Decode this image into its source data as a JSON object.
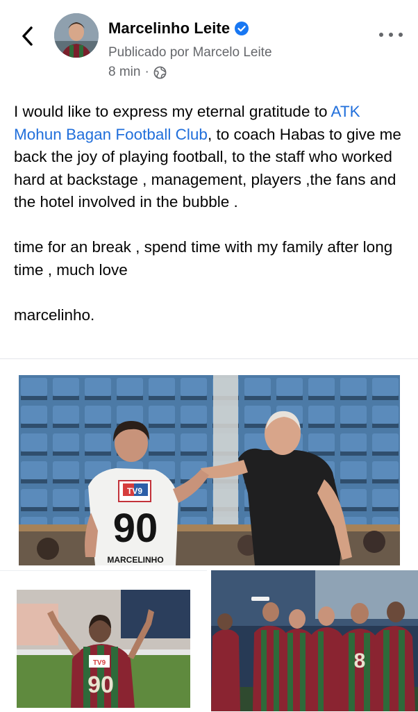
{
  "header": {
    "author_name": "Marcelinho Leite",
    "published_by": "Publicado por Marcelo Leite",
    "time": "8 min",
    "separator": "·"
  },
  "icons": {
    "back": "chevron-left-icon",
    "verified": "verified-badge-icon",
    "audience": "globe-icon",
    "more": "more-horizontal-icon"
  },
  "post": {
    "p1_before": "I would like to express my eternal gratitude to ",
    "p1_link": "ATK Mohun Bagan Football Club",
    "p1_after": ", to coach Habas to give me back the joy of playing football, to the staff who worked hard at backstage , management, players ,the fans and the hotel involved in the bubble .",
    "p2": "time for an break , spend time with my family after long time , much love",
    "p3": "marcelinho."
  },
  "photos": {
    "main": {
      "jersey_number": "90",
      "jersey_name": "MARCELINHO",
      "sponsor": "TV9"
    },
    "left": {
      "jersey_number": "90",
      "sponsor": "TV9"
    },
    "right": {
      "jersey_number": "8"
    }
  },
  "colors": {
    "link": "#216fdb",
    "verified": "#1877f2",
    "secondary_text": "#65676b",
    "divider": "#e4e6eb"
  }
}
